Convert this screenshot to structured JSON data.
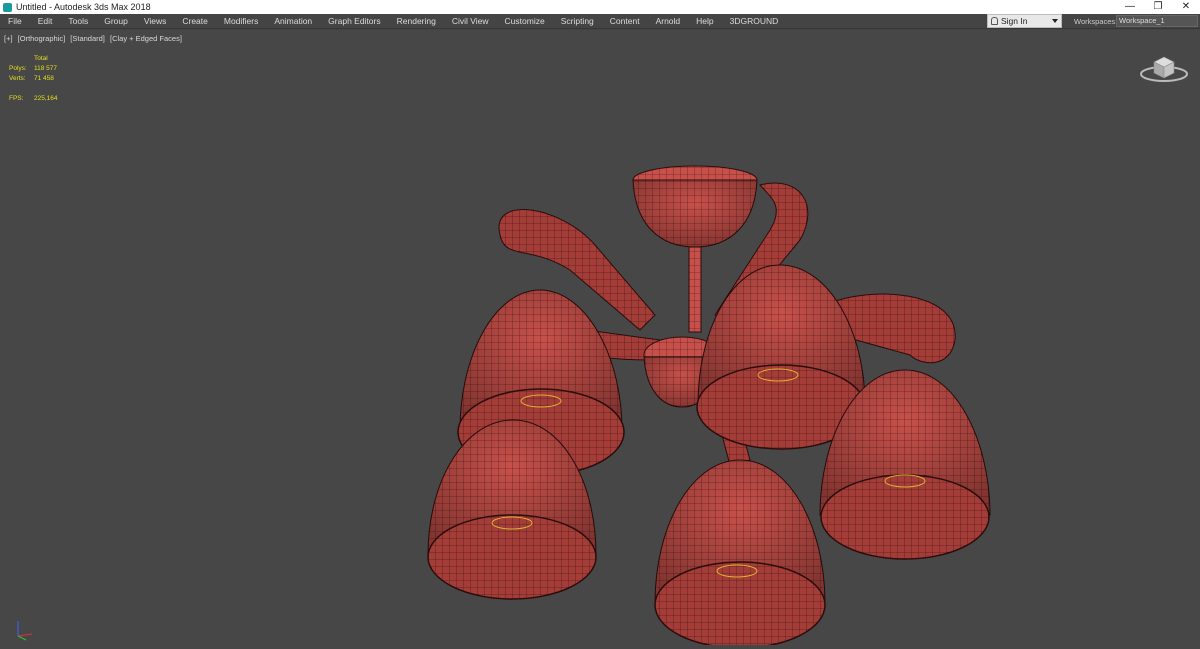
{
  "window": {
    "title": "Untitled - Autodesk 3ds Max 2018",
    "controls": [
      "—",
      "❐",
      "✕"
    ]
  },
  "menu": [
    "File",
    "Edit",
    "Tools",
    "Group",
    "Views",
    "Create",
    "Modifiers",
    "Animation",
    "Graph Editors",
    "Rendering",
    "Civil View",
    "Customize",
    "Scripting",
    "Content",
    "Arnold",
    "Help",
    "3DGROUND"
  ],
  "signin": {
    "label": "Sign In"
  },
  "workspaces": {
    "label": "Workspaces:",
    "value": "Workspace_1"
  },
  "viewport": {
    "labels": [
      "[+]",
      "[Orthographic]",
      "[Standard]",
      "[Clay + Edged Faces]"
    ],
    "stats": {
      "header": "Total",
      "polys_label": "Polys:",
      "polys_value": "118 577",
      "verts_label": "Verts:",
      "verts_value": "71 458",
      "fps_label": "FPS:",
      "fps_value": "225,164"
    },
    "model_color": "#c8504a",
    "wire_color": "#3a1412"
  },
  "icons": {
    "viewcube": "viewcube-icon",
    "tripod": "axis-tripod-icon",
    "user": "user-icon"
  }
}
